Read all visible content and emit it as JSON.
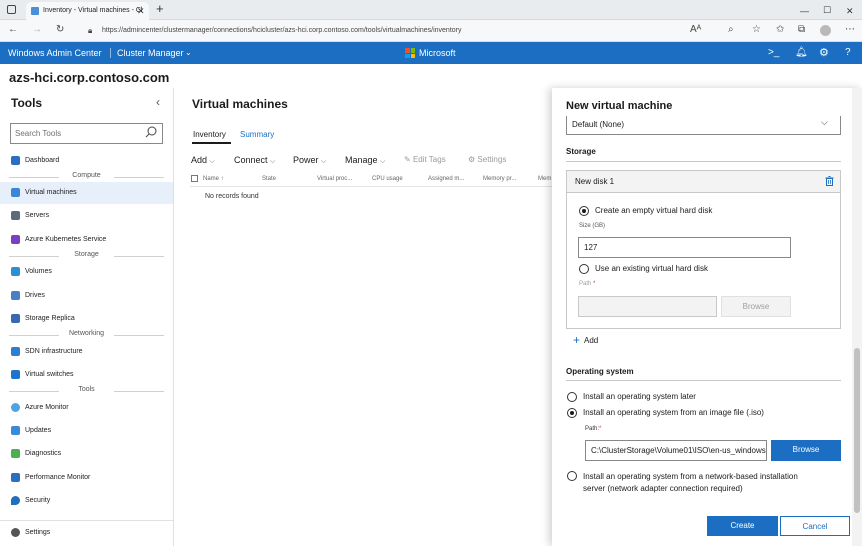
{
  "browser": {
    "tab_title": "Inventory - Virtual machines - Cl",
    "url": "https://admincenter/clustermanager/connections/hcicluster/azs-hci.corp.contoso.com/tools/virtualmachines/inventory"
  },
  "header": {
    "app_name": "Windows Admin Center",
    "context": "Cluster Manager",
    "brand": "Microsoft"
  },
  "host": "azs-hci.corp.contoso.com",
  "sidebar": {
    "title": "Tools",
    "search_placeholder": "Search Tools",
    "items": [
      {
        "label": "Dashboard"
      },
      {
        "label": "Compute",
        "section": true
      },
      {
        "label": "Virtual machines",
        "selected": true
      },
      {
        "label": "Servers"
      },
      {
        "label": "Azure Kubernetes Service"
      },
      {
        "label": "Storage",
        "section": true
      },
      {
        "label": "Volumes"
      },
      {
        "label": "Drives"
      },
      {
        "label": "Storage Replica"
      },
      {
        "label": "Networking",
        "section": true
      },
      {
        "label": "SDN infrastructure"
      },
      {
        "label": "Virtual switches"
      },
      {
        "label": "Tools",
        "section": true
      },
      {
        "label": "Azure Monitor"
      },
      {
        "label": "Updates"
      },
      {
        "label": "Diagnostics"
      },
      {
        "label": "Performance Monitor"
      },
      {
        "label": "Security"
      },
      {
        "label": "Settings"
      }
    ]
  },
  "main": {
    "title": "Virtual machines",
    "tabs": [
      "Inventory",
      "Summary"
    ],
    "toolbar": {
      "add": "Add",
      "connect": "Connect",
      "power": "Power",
      "manage": "Manage",
      "edit_tags": "Edit Tags",
      "settings": "Settings"
    },
    "columns": [
      "Name ↑",
      "State",
      "Virtual proc...",
      "CPU usage",
      "Assigned m...",
      "Memory pr...",
      "Mem"
    ],
    "empty_text": "No records found"
  },
  "panel": {
    "title": "New virtual machine",
    "default_select": "Default (None)",
    "storage_heading": "Storage",
    "disk_title": "New disk 1",
    "opt_create_empty": "Create an empty virtual hard disk",
    "size_label": "Size (GB)",
    "size_value": "127",
    "opt_existing": "Use an existing virtual hard disk",
    "path_label": "Path",
    "browse": "Browse",
    "add": "Add",
    "os_heading": "Operating system",
    "os_later": "Install an operating system later",
    "os_image": "Install an operating system from an image file (.iso)",
    "os_path_label": "Path:",
    "os_path_value": "C:\\ClusterStorage\\Volume01\\ISO\\en-us_windows",
    "os_network_line1": "Install an operating system from a network-based installation",
    "os_network_line2": "server (network adapter connection required)",
    "create": "Create",
    "cancel": "Cancel",
    "required_mark": "*"
  },
  "colors": {
    "accent": "#1b6ec2",
    "selected_bg": "#e6effa"
  }
}
